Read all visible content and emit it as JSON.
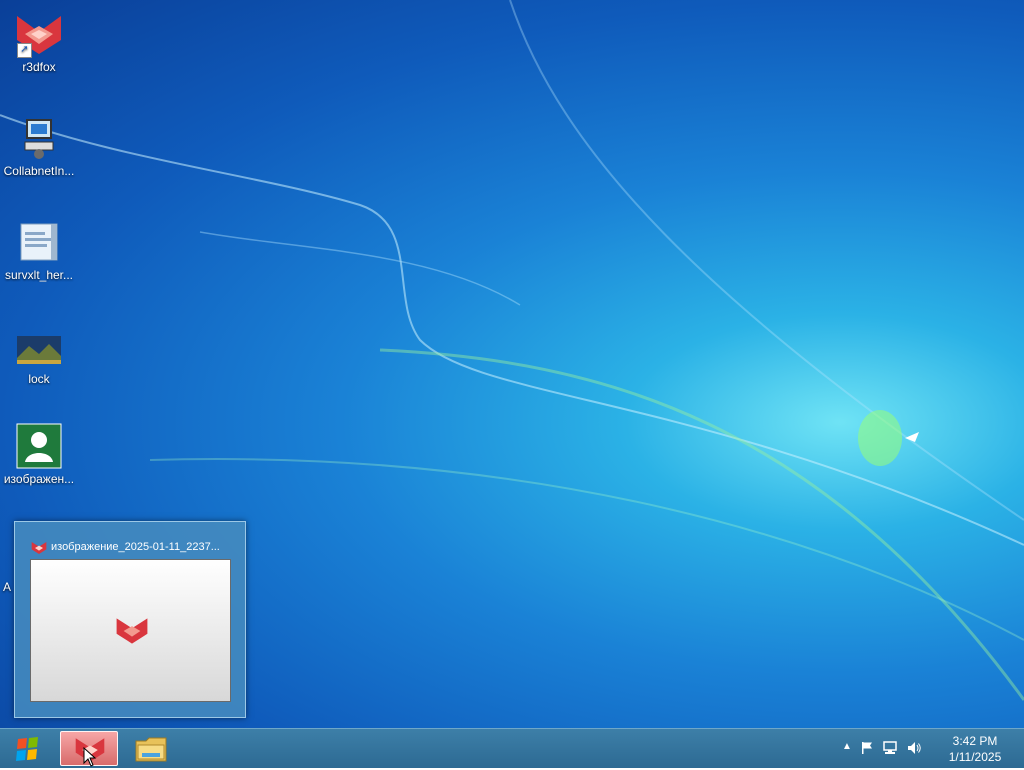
{
  "desktop": {
    "icons": [
      {
        "label": "r3dfox",
        "icon": "r3dfox-icon"
      },
      {
        "label": "CollabnetIn...",
        "icon": "computer-setup-icon"
      },
      {
        "label": "survxlt_her...",
        "icon": "document-icon"
      },
      {
        "label": "lock",
        "icon": "landscape-image-icon"
      },
      {
        "label": "изображен...",
        "icon": "user-image-icon"
      }
    ],
    "hidden_icon_partial_label": "A"
  },
  "preview": {
    "title": "изображение_2025-01-11_2237..."
  },
  "taskbar": {
    "start_icon": "windows-logo-icon",
    "tasks": [
      {
        "name": "r3dfox",
        "icon": "r3dfox-icon",
        "active": true
      },
      {
        "name": "Windows Explorer",
        "icon": "folder-icon",
        "active": false
      }
    ],
    "tray": {
      "show_hidden_icon": "chevron-up-icon",
      "icons": [
        "action-center-flag-icon",
        "network-icon",
        "volume-icon"
      ],
      "time": "3:42 PM",
      "date": "1/11/2025"
    }
  },
  "colors": {
    "accent_red": "#d9363e",
    "taskbar": "#2d6a93"
  }
}
